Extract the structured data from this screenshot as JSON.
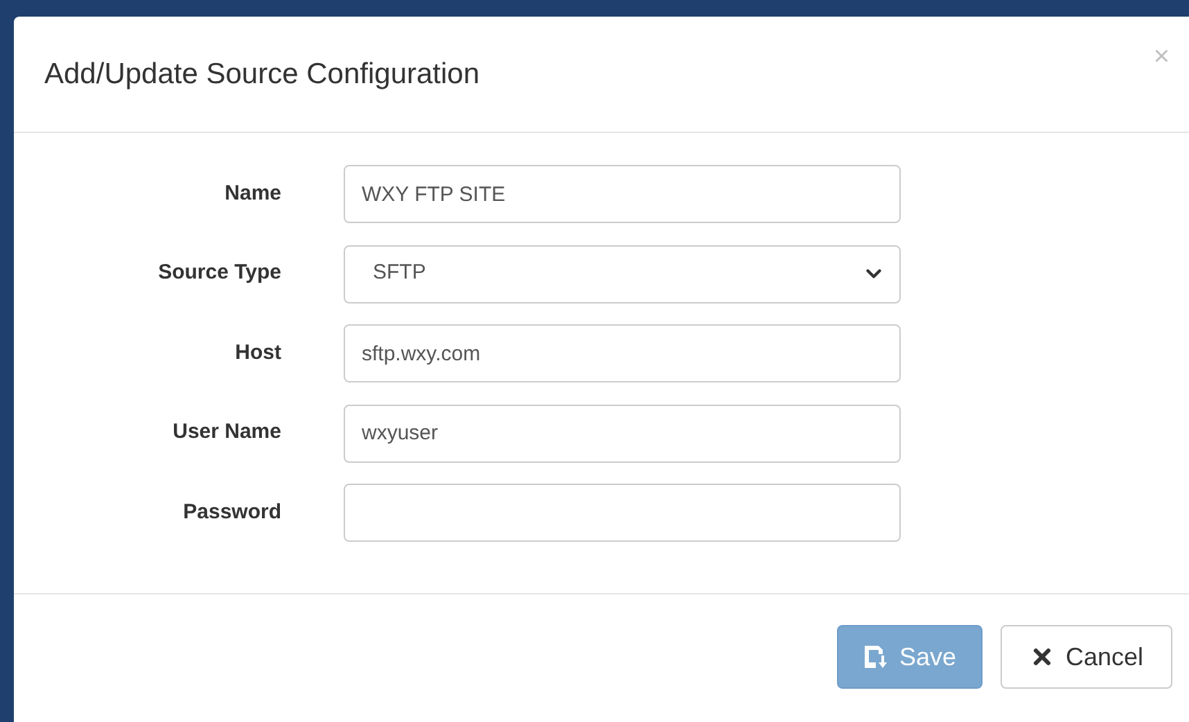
{
  "dialog": {
    "title": "Add/Update Source Configuration",
    "close": "×"
  },
  "fields": [
    {
      "label": "Name",
      "kind": "text",
      "value": "WXY FTP SITE"
    },
    {
      "label": "Source Type",
      "kind": "select",
      "value": "SFTP"
    },
    {
      "label": "Host",
      "kind": "text",
      "value": "sftp.wxy.com"
    },
    {
      "label": "User Name",
      "kind": "text",
      "value": "wxyuser"
    },
    {
      "label": "Password",
      "kind": "password"
    }
  ],
  "buttons": [
    {
      "label": "Save",
      "kind": "save",
      "disabled": true
    },
    {
      "label": "Cancel",
      "kind": "cancel",
      "disabled": false
    }
  ]
}
